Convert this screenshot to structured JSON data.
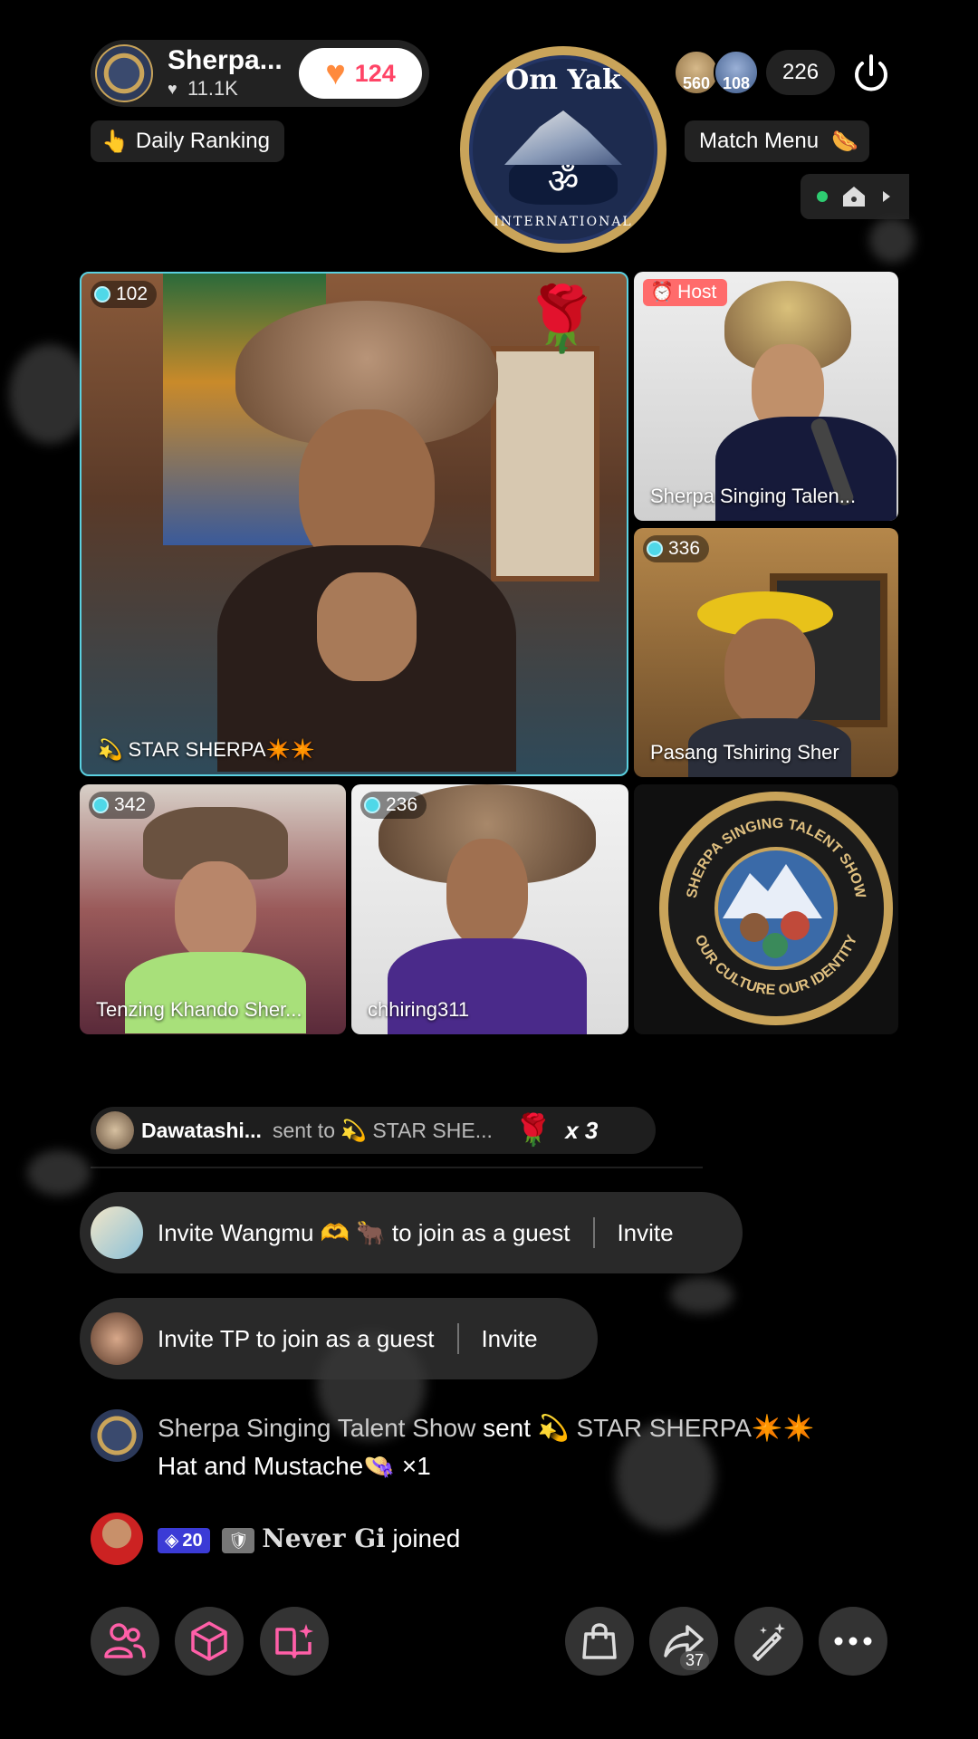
{
  "host": {
    "name": "Sherpa...",
    "likes": "11.1K",
    "follow_count": "124"
  },
  "daily_ranking": {
    "icon": "👆",
    "label": "Daily Ranking"
  },
  "logo": {
    "top_text": "Om Yak",
    "bottom_text": "INTERNATIONAL",
    "symbol": "ॐ"
  },
  "viewers": {
    "avatar1_badge": "560",
    "avatar2_badge": "108",
    "count": "226"
  },
  "match_menu": {
    "label": "Match Menu",
    "icon": "🌭"
  },
  "tiles": {
    "main": {
      "count": "102",
      "label": "💫 STAR SHERPA✴️✴️",
      "sticker": "🌹"
    },
    "host": {
      "badge": "Host",
      "label": "Sherpa Singing Talen..."
    },
    "guest2": {
      "count": "336",
      "label": "Pasang Tshiring Sher"
    },
    "guest3": {
      "count": "342",
      "label": "Tenzing Khando Sher..."
    },
    "guest4": {
      "count": "236",
      "label": "chhiring311"
    },
    "emblem": {
      "top_text": "SHERPA SINGING TALENT SHOW",
      "bottom_text": "OUR CULTURE OUR IDENTITY"
    }
  },
  "gift_banner": {
    "sender": "Dawatashi...",
    "sent_to": "sent to 💫 STAR SHE...",
    "gift_icon": "🌹",
    "multiplier": "x 3"
  },
  "invites": [
    {
      "text": "Invite Wangmu 🫶 🐂 to join as a guest",
      "button": "Invite"
    },
    {
      "text": "Invite TP to join as a guest",
      "button": "Invite"
    }
  ],
  "chat": [
    {
      "sender": "Sherpa Singing Talent Show",
      "action": "sent",
      "target": "💫 STAR SHERPA✴️✴️",
      "gift": "Hat and Mustache",
      "gift_icon": "👒",
      "qty": "×1"
    },
    {
      "level": "20",
      "fan_icon": "🛡",
      "name": "Never Gi",
      "action": "joined"
    }
  ],
  "bottom_bar": {
    "share_count": "37"
  },
  "colors": {
    "background": "#000000",
    "host_badge": "#ff6b6b",
    "follow_heart": "#ff8a3d",
    "follow_count": "#ff4466",
    "level_badge": "#3b3bd6",
    "icon_pink": "#ff5fa8",
    "gem": "#4fd8e8"
  }
}
